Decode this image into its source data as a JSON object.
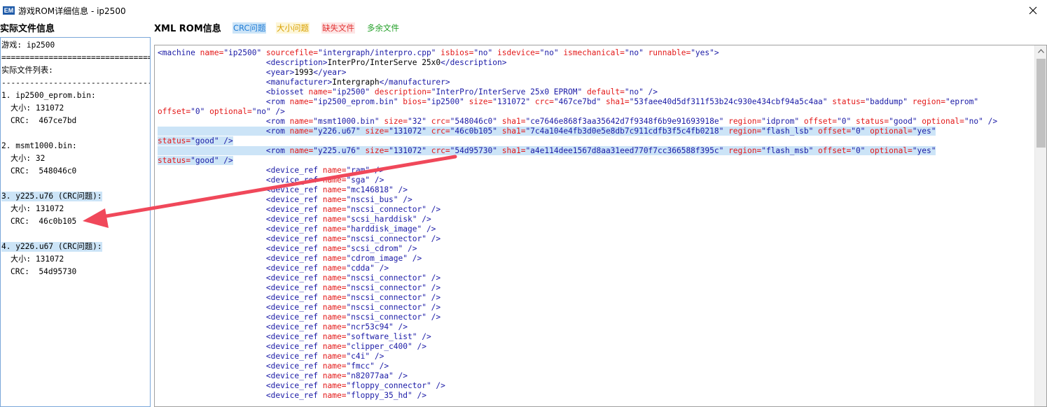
{
  "window": {
    "icon_text": "EM",
    "title": "游戏ROM详细信息 - ip2500"
  },
  "left": {
    "header": "实际文件信息",
    "lines": [
      {
        "text": "游戏: ip2500",
        "indent": false,
        "hl": false
      },
      {
        "text": "======================================",
        "indent": false,
        "hl": false
      },
      {
        "text": "实际文件列表:",
        "indent": false,
        "hl": false
      },
      {
        "text": "--------------------------------------",
        "indent": false,
        "hl": false
      },
      {
        "text": "1. ip2500_eprom.bin:",
        "indent": false,
        "hl": false
      },
      {
        "text": "大小: 131072",
        "indent": true,
        "hl": false
      },
      {
        "text": "CRC:  467ce7bd",
        "indent": true,
        "hl": false
      },
      {
        "text": "",
        "indent": false,
        "hl": false
      },
      {
        "text": "2. msmt1000.bin:",
        "indent": false,
        "hl": false
      },
      {
        "text": "大小: 32",
        "indent": true,
        "hl": false
      },
      {
        "text": "CRC:  548046c0",
        "indent": true,
        "hl": false
      },
      {
        "text": "",
        "indent": false,
        "hl": false
      },
      {
        "text": "3. y225.u76 (CRC问题):",
        "indent": false,
        "hl": true
      },
      {
        "text": "大小: 131072",
        "indent": true,
        "hl": false
      },
      {
        "text": "CRC:  46c0b105",
        "indent": true,
        "hl": false
      },
      {
        "text": "",
        "indent": false,
        "hl": false
      },
      {
        "text": "4. y226.u67 (CRC问题):",
        "indent": false,
        "hl": true
      },
      {
        "text": "大小: 131072",
        "indent": true,
        "hl": false
      },
      {
        "text": "CRC:  54d95730",
        "indent": true,
        "hl": false
      }
    ]
  },
  "right": {
    "header": "XML ROM信息",
    "legend": {
      "crc": "CRC问题",
      "size": "大小问题",
      "missing": "缺失文件",
      "extra": "多余文件"
    },
    "xml_lines": [
      [
        {
          "c": "t",
          "s": "<machine "
        },
        {
          "c": "a",
          "s": "name="
        },
        {
          "c": "v",
          "s": "\"ip2500\" "
        },
        {
          "c": "a",
          "s": "sourcefile="
        },
        {
          "c": "v",
          "s": "\"intergraph/interpro.cpp\" "
        },
        {
          "c": "a",
          "s": "isbios="
        },
        {
          "c": "v",
          "s": "\"no\" "
        },
        {
          "c": "a",
          "s": "isdevice="
        },
        {
          "c": "v",
          "s": "\"no\" "
        },
        {
          "c": "a",
          "s": "ismechanical="
        },
        {
          "c": "v",
          "s": "\"no\" "
        },
        {
          "c": "a",
          "s": "runnable="
        },
        {
          "c": "v",
          "s": "\"yes\">"
        }
      ],
      [
        {
          "c": "x",
          "s": "                       "
        },
        {
          "c": "t",
          "s": "<description>"
        },
        {
          "c": "x",
          "s": "InterPro/InterServe 25x0"
        },
        {
          "c": "t",
          "s": "</description>"
        }
      ],
      [
        {
          "c": "x",
          "s": "                       "
        },
        {
          "c": "t",
          "s": "<year>"
        },
        {
          "c": "x",
          "s": "1993"
        },
        {
          "c": "t",
          "s": "</year>"
        }
      ],
      [
        {
          "c": "x",
          "s": "                       "
        },
        {
          "c": "t",
          "s": "<manufacturer>"
        },
        {
          "c": "x",
          "s": "Intergraph"
        },
        {
          "c": "t",
          "s": "</manufacturer>"
        }
      ],
      [
        {
          "c": "x",
          "s": "                       "
        },
        {
          "c": "t",
          "s": "<biosset "
        },
        {
          "c": "a",
          "s": "name="
        },
        {
          "c": "v",
          "s": "\"ip2500\" "
        },
        {
          "c": "a",
          "s": "description="
        },
        {
          "c": "v",
          "s": "\"InterPro/InterServe 25x0 EPROM\" "
        },
        {
          "c": "a",
          "s": "default="
        },
        {
          "c": "v",
          "s": "\"no\" />"
        }
      ],
      [
        {
          "c": "x",
          "s": "                       "
        },
        {
          "c": "t",
          "s": "<rom "
        },
        {
          "c": "a",
          "s": "name="
        },
        {
          "c": "v",
          "s": "\"ip2500_eprom.bin\" "
        },
        {
          "c": "a",
          "s": "bios="
        },
        {
          "c": "v",
          "s": "\"ip2500\" "
        },
        {
          "c": "a",
          "s": "size="
        },
        {
          "c": "v",
          "s": "\"131072\" "
        },
        {
          "c": "a",
          "s": "crc="
        },
        {
          "c": "v",
          "s": "\"467ce7bd\" "
        },
        {
          "c": "a",
          "s": "sha1="
        },
        {
          "c": "v",
          "s": "\"53faee40d5df311f53b24c930e434cbf94a5c4aa\" "
        },
        {
          "c": "a",
          "s": "status="
        },
        {
          "c": "v",
          "s": "\"baddump\" "
        },
        {
          "c": "a",
          "s": "region="
        },
        {
          "c": "v",
          "s": "\"eprom\""
        }
      ],
      [
        {
          "c": "a",
          "s": "offset="
        },
        {
          "c": "v",
          "s": "\"0\" "
        },
        {
          "c": "a",
          "s": "optional="
        },
        {
          "c": "v",
          "s": "\"no\" />"
        }
      ],
      [
        {
          "c": "x",
          "s": "                       "
        },
        {
          "c": "t",
          "s": "<rom "
        },
        {
          "c": "a",
          "s": "name="
        },
        {
          "c": "v",
          "s": "\"msmt1000.bin\" "
        },
        {
          "c": "a",
          "s": "size="
        },
        {
          "c": "v",
          "s": "\"32\" "
        },
        {
          "c": "a",
          "s": "crc="
        },
        {
          "c": "v",
          "s": "\"548046c0\" "
        },
        {
          "c": "a",
          "s": "sha1="
        },
        {
          "c": "v",
          "s": "\"ce7646e868f3aa35642d7f9348f6b9e91693918e\" "
        },
        {
          "c": "a",
          "s": "region="
        },
        {
          "c": "v",
          "s": "\"idprom\" "
        },
        {
          "c": "a",
          "s": "offset="
        },
        {
          "c": "v",
          "s": "\"0\" "
        },
        {
          "c": "a",
          "s": "status="
        },
        {
          "c": "v",
          "s": "\"good\" "
        },
        {
          "c": "a",
          "s": "optional="
        },
        {
          "c": "v",
          "s": "\"no\" />"
        }
      ],
      [
        {
          "c": "x",
          "s": "                       ",
          "h": 1
        },
        {
          "c": "t",
          "s": "<rom ",
          "h": 1
        },
        {
          "c": "a",
          "s": "name=",
          "h": 1
        },
        {
          "c": "v",
          "s": "\"y226.u67\" ",
          "h": 1
        },
        {
          "c": "a",
          "s": "size=",
          "h": 1
        },
        {
          "c": "v",
          "s": "\"131072\" ",
          "h": 1
        },
        {
          "c": "a",
          "s": "crc=",
          "h": 1
        },
        {
          "c": "v",
          "s": "\"46c0b105\" ",
          "h": 1
        },
        {
          "c": "a",
          "s": "sha1=",
          "h": 1
        },
        {
          "c": "v",
          "s": "\"7c4a104e4fb3d0e5e8db7c911cdfb3f5c4fb0218\" ",
          "h": 1
        },
        {
          "c": "a",
          "s": "region=",
          "h": 1
        },
        {
          "c": "v",
          "s": "\"flash_lsb\" ",
          "h": 1
        },
        {
          "c": "a",
          "s": "offset=",
          "h": 1
        },
        {
          "c": "v",
          "s": "\"0\" ",
          "h": 1
        },
        {
          "c": "a",
          "s": "optional=",
          "h": 1
        },
        {
          "c": "v",
          "s": "\"yes\"",
          "h": 1
        }
      ],
      [
        {
          "c": "a",
          "s": "status=",
          "h": 1
        },
        {
          "c": "v",
          "s": "\"good\" />",
          "h": 1
        }
      ],
      [
        {
          "c": "x",
          "s": "                       ",
          "h": 1
        },
        {
          "c": "t",
          "s": "<rom ",
          "h": 1
        },
        {
          "c": "a",
          "s": "name=",
          "h": 1
        },
        {
          "c": "v",
          "s": "\"y225.u76\" ",
          "h": 1
        },
        {
          "c": "a",
          "s": "size=",
          "h": 1
        },
        {
          "c": "v",
          "s": "\"131072\" ",
          "h": 1
        },
        {
          "c": "a",
          "s": "crc=",
          "h": 1
        },
        {
          "c": "v",
          "s": "\"54d95730\" ",
          "h": 1
        },
        {
          "c": "a",
          "s": "sha1=",
          "h": 1
        },
        {
          "c": "v",
          "s": "\"a4e114dee1567d8aa31eed770f7cc366588f395c\" ",
          "h": 1
        },
        {
          "c": "a",
          "s": "region=",
          "h": 1
        },
        {
          "c": "v",
          "s": "\"flash_msb\" ",
          "h": 1
        },
        {
          "c": "a",
          "s": "offset=",
          "h": 1
        },
        {
          "c": "v",
          "s": "\"0\" ",
          "h": 1
        },
        {
          "c": "a",
          "s": "optional=",
          "h": 1
        },
        {
          "c": "v",
          "s": "\"yes\"",
          "h": 1
        }
      ],
      [
        {
          "c": "a",
          "s": "status=",
          "h": 1
        },
        {
          "c": "v",
          "s": "\"good\" />",
          "h": 1
        }
      ],
      [
        {
          "c": "x",
          "s": "                       "
        },
        {
          "c": "t",
          "s": "<device_ref "
        },
        {
          "c": "a",
          "s": "name="
        },
        {
          "c": "v",
          "s": "\"ram\" />"
        }
      ],
      [
        {
          "c": "x",
          "s": "                       "
        },
        {
          "c": "t",
          "s": "<device_ref "
        },
        {
          "c": "a",
          "s": "name="
        },
        {
          "c": "v",
          "s": "\"sga\" />"
        }
      ],
      [
        {
          "c": "x",
          "s": "                       "
        },
        {
          "c": "t",
          "s": "<device_ref "
        },
        {
          "c": "a",
          "s": "name="
        },
        {
          "c": "v",
          "s": "\"mc146818\" />"
        }
      ],
      [
        {
          "c": "x",
          "s": "                       "
        },
        {
          "c": "t",
          "s": "<device_ref "
        },
        {
          "c": "a",
          "s": "name="
        },
        {
          "c": "v",
          "s": "\"nscsi_bus\" />"
        }
      ],
      [
        {
          "c": "x",
          "s": "                       "
        },
        {
          "c": "t",
          "s": "<device_ref "
        },
        {
          "c": "a",
          "s": "name="
        },
        {
          "c": "v",
          "s": "\"nscsi_connector\" />"
        }
      ],
      [
        {
          "c": "x",
          "s": "                       "
        },
        {
          "c": "t",
          "s": "<device_ref "
        },
        {
          "c": "a",
          "s": "name="
        },
        {
          "c": "v",
          "s": "\"scsi_harddisk\" />"
        }
      ],
      [
        {
          "c": "x",
          "s": "                       "
        },
        {
          "c": "t",
          "s": "<device_ref "
        },
        {
          "c": "a",
          "s": "name="
        },
        {
          "c": "v",
          "s": "\"harddisk_image\" />"
        }
      ],
      [
        {
          "c": "x",
          "s": "                       "
        },
        {
          "c": "t",
          "s": "<device_ref "
        },
        {
          "c": "a",
          "s": "name="
        },
        {
          "c": "v",
          "s": "\"nscsi_connector\" />"
        }
      ],
      [
        {
          "c": "x",
          "s": "                       "
        },
        {
          "c": "t",
          "s": "<device_ref "
        },
        {
          "c": "a",
          "s": "name="
        },
        {
          "c": "v",
          "s": "\"scsi_cdrom\" />"
        }
      ],
      [
        {
          "c": "x",
          "s": "                       "
        },
        {
          "c": "t",
          "s": "<device_ref "
        },
        {
          "c": "a",
          "s": "name="
        },
        {
          "c": "v",
          "s": "\"cdrom_image\" />"
        }
      ],
      [
        {
          "c": "x",
          "s": "                       "
        },
        {
          "c": "t",
          "s": "<device_ref "
        },
        {
          "c": "a",
          "s": "name="
        },
        {
          "c": "v",
          "s": "\"cdda\" />"
        }
      ],
      [
        {
          "c": "x",
          "s": "                       "
        },
        {
          "c": "t",
          "s": "<device_ref "
        },
        {
          "c": "a",
          "s": "name="
        },
        {
          "c": "v",
          "s": "\"nscsi_connector\" />"
        }
      ],
      [
        {
          "c": "x",
          "s": "                       "
        },
        {
          "c": "t",
          "s": "<device_ref "
        },
        {
          "c": "a",
          "s": "name="
        },
        {
          "c": "v",
          "s": "\"nscsi_connector\" />"
        }
      ],
      [
        {
          "c": "x",
          "s": "                       "
        },
        {
          "c": "t",
          "s": "<device_ref "
        },
        {
          "c": "a",
          "s": "name="
        },
        {
          "c": "v",
          "s": "\"nscsi_connector\" />"
        }
      ],
      [
        {
          "c": "x",
          "s": "                       "
        },
        {
          "c": "t",
          "s": "<device_ref "
        },
        {
          "c": "a",
          "s": "name="
        },
        {
          "c": "v",
          "s": "\"nscsi_connector\" />"
        }
      ],
      [
        {
          "c": "x",
          "s": "                       "
        },
        {
          "c": "t",
          "s": "<device_ref "
        },
        {
          "c": "a",
          "s": "name="
        },
        {
          "c": "v",
          "s": "\"nscsi_connector\" />"
        }
      ],
      [
        {
          "c": "x",
          "s": "                       "
        },
        {
          "c": "t",
          "s": "<device_ref "
        },
        {
          "c": "a",
          "s": "name="
        },
        {
          "c": "v",
          "s": "\"ncr53c94\" />"
        }
      ],
      [
        {
          "c": "x",
          "s": "                       "
        },
        {
          "c": "t",
          "s": "<device_ref "
        },
        {
          "c": "a",
          "s": "name="
        },
        {
          "c": "v",
          "s": "\"software_list\" />"
        }
      ],
      [
        {
          "c": "x",
          "s": "                       "
        },
        {
          "c": "t",
          "s": "<device_ref "
        },
        {
          "c": "a",
          "s": "name="
        },
        {
          "c": "v",
          "s": "\"clipper_c400\" />"
        }
      ],
      [
        {
          "c": "x",
          "s": "                       "
        },
        {
          "c": "t",
          "s": "<device_ref "
        },
        {
          "c": "a",
          "s": "name="
        },
        {
          "c": "v",
          "s": "\"c4i\" />"
        }
      ],
      [
        {
          "c": "x",
          "s": "                       "
        },
        {
          "c": "t",
          "s": "<device_ref "
        },
        {
          "c": "a",
          "s": "name="
        },
        {
          "c": "v",
          "s": "\"fmcc\" />"
        }
      ],
      [
        {
          "c": "x",
          "s": "                       "
        },
        {
          "c": "t",
          "s": "<device_ref "
        },
        {
          "c": "a",
          "s": "name="
        },
        {
          "c": "v",
          "s": "\"n82077aa\" />"
        }
      ],
      [
        {
          "c": "x",
          "s": "                       "
        },
        {
          "c": "t",
          "s": "<device_ref "
        },
        {
          "c": "a",
          "s": "name="
        },
        {
          "c": "v",
          "s": "\"floppy_connector\" />"
        }
      ],
      [
        {
          "c": "x",
          "s": "                       "
        },
        {
          "c": "t",
          "s": "<device_ref "
        },
        {
          "c": "a",
          "s": "name="
        },
        {
          "c": "v",
          "s": "\"floppy_35_hd\" />"
        }
      ]
    ]
  },
  "colors": {
    "tag": "#1a1aa6",
    "attr": "#e31919",
    "highlight": "#cce4f7",
    "arrow": "#f0485a"
  },
  "icons": {
    "close": "close-icon",
    "scroll_up": "chevron-up-icon",
    "annotation": "arrow-annotation"
  }
}
